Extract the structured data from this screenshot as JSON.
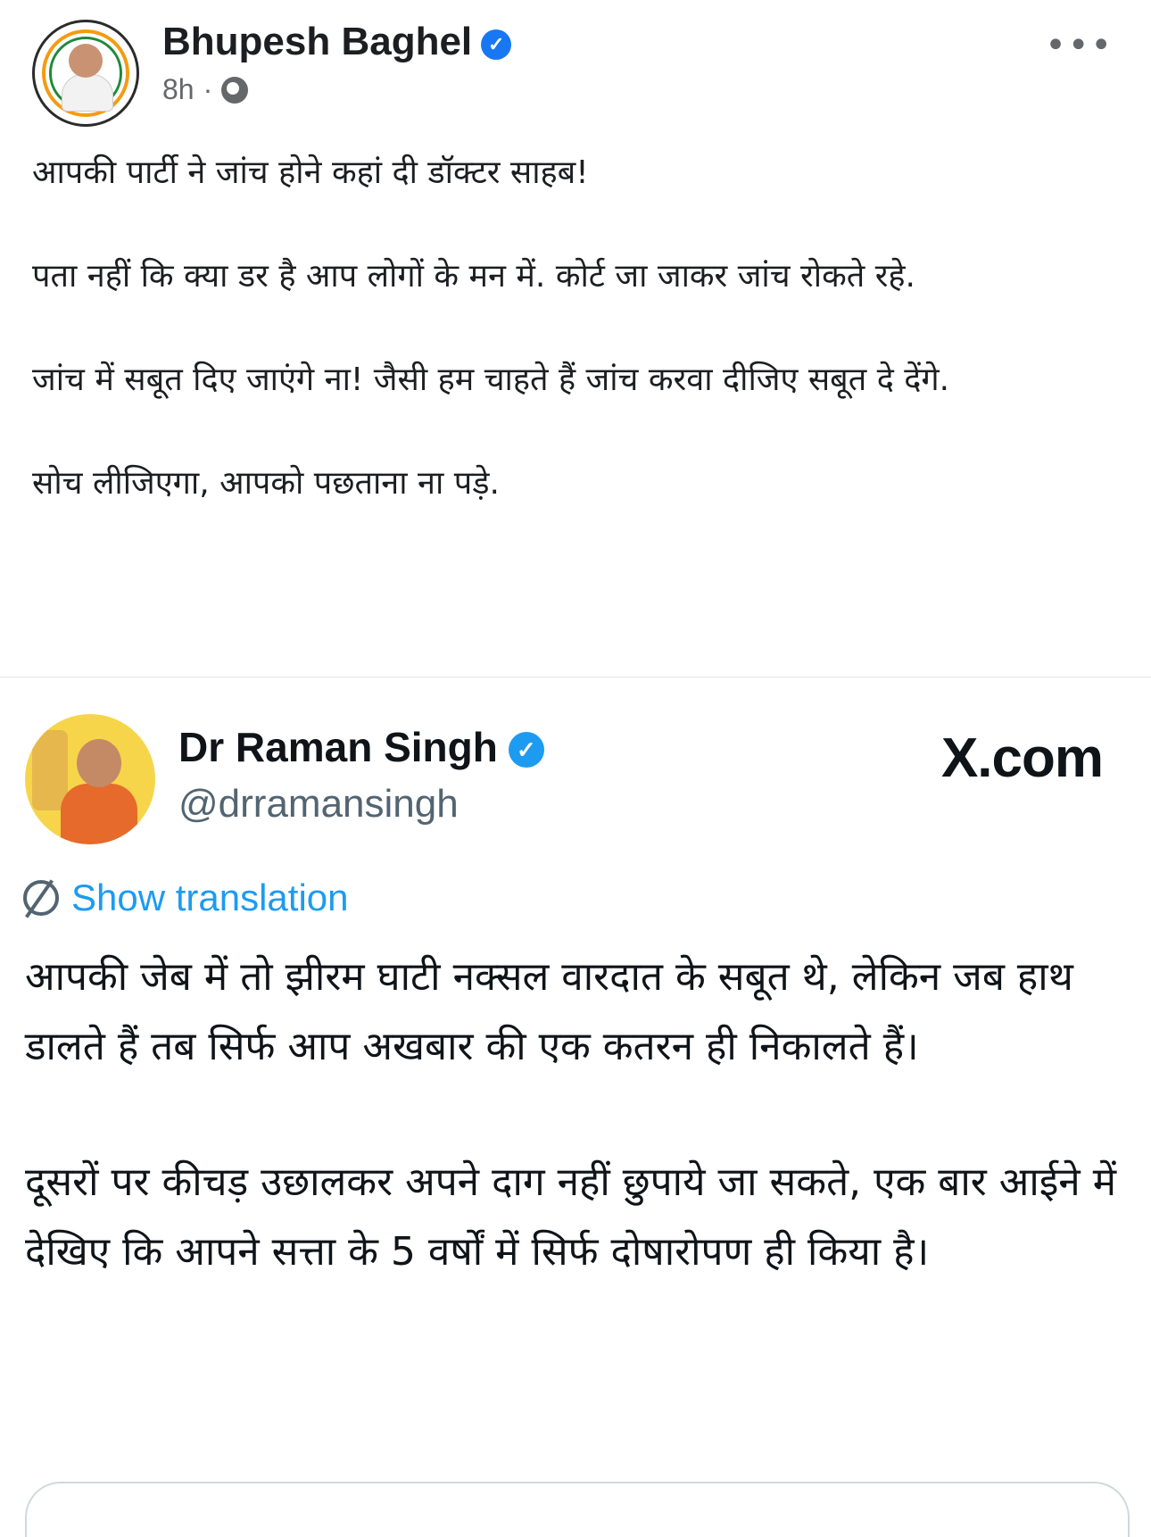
{
  "fb_post": {
    "author": "Bhupesh Baghel",
    "time": "8h",
    "separator": "·",
    "more": "•••",
    "paragraphs": [
      "आपकी पार्टी ने जांच होने कहां दी डॉक्टर साहब!",
      "पता नहीं कि क्या डर है आप लोगों के मन में. कोर्ट जा जाकर जांच रोकते रहे.",
      "जांच में सबूत दिए जाएंगे ना! जैसी हम चाहते हैं जांच करवा दीजिए सबूत दे देंगे.",
      "सोच लीजिएगा, आपको पछताना ना पड़े."
    ]
  },
  "x_post": {
    "name": "Dr Raman Singh",
    "handle": "@drramansingh",
    "site": "X.com",
    "show_translation": "Show translation",
    "paragraphs": [
      "आपकी जेब में तो झीरम घाटी नक्सल वारदात के सबूत थे, लेकिन जब हाथ डालते हैं तब सिर्फ आप अखबार की एक कतरन ही निकालते हैं।",
      "दूसरों पर कीचड़ उछालकर अपने दाग नहीं छुपाये जा सकते, एक बार आईने में देखिए कि आपने सत्ता के 5 वर्षों में सिर्फ दोषारोपण ही किया है।"
    ]
  },
  "icons": {
    "verified": "verified-badge-icon",
    "globe": "globe-icon",
    "translate": "translate-icon"
  },
  "colors": {
    "fb_verified": "#1877f2",
    "x_verified": "#1d9bf0",
    "link": "#1d9bf0",
    "muted": "#65676b"
  }
}
